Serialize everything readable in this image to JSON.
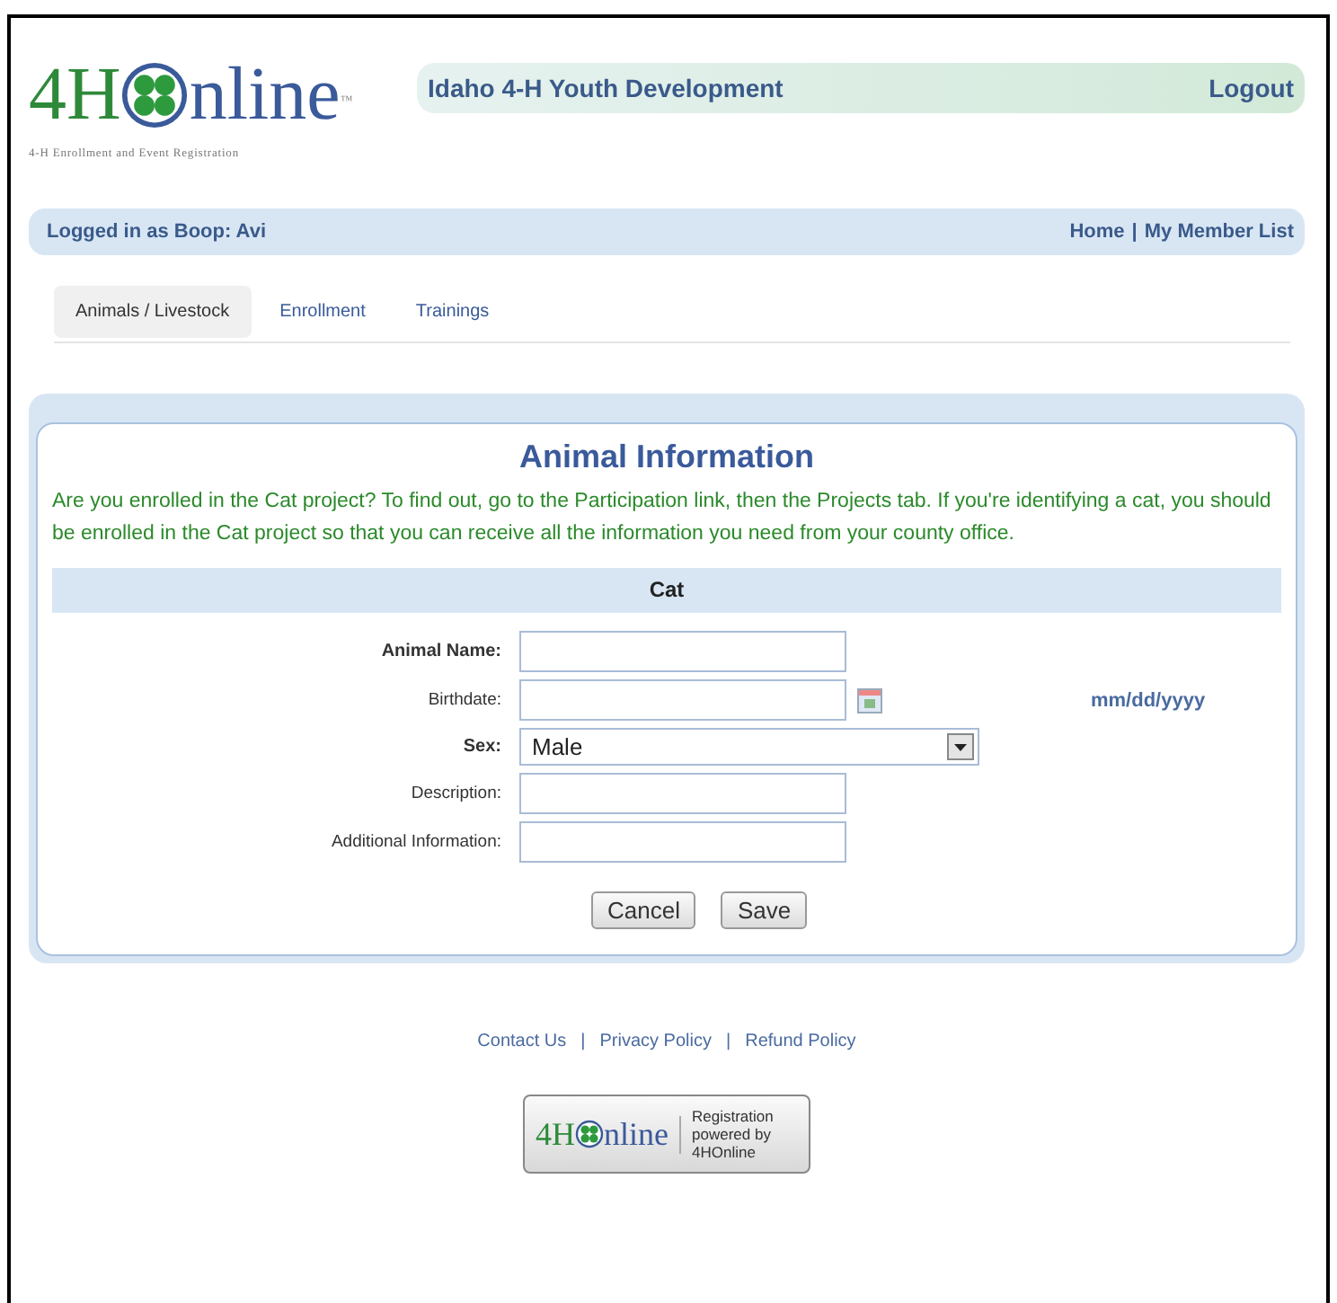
{
  "header": {
    "logo": {
      "lead": "4H",
      "tail": "nline",
      "mark": "™",
      "tagline": "4-H Enrollment and Event Registration"
    },
    "title": "Idaho 4-H Youth Development",
    "logout": "Logout"
  },
  "user_bar": {
    "status": "Logged in as Boop: Avi",
    "links": [
      "Home",
      "My Member List"
    ],
    "separator": "|"
  },
  "tabs": [
    {
      "label": "Animals / Livestock",
      "selected": true
    },
    {
      "label": "Enrollment",
      "selected": false
    },
    {
      "label": "Trainings",
      "selected": false
    }
  ],
  "card": {
    "title": "Animal Information",
    "message": "Are you enrolled in the Cat project? To find out, go to the Participation link, then the Projects tab. If you're identifying a cat, you should be enrolled in the Cat project so that you can receive all the information you need from your county office.",
    "section": "Cat",
    "fields": [
      {
        "label": "Animal Name:",
        "kind": "text",
        "required": true
      },
      {
        "label": "Birthdate:",
        "kind": "date",
        "required": false,
        "hint": "mm/dd/yyyy"
      },
      {
        "label": "Sex:",
        "kind": "select",
        "required": true,
        "value": "Male"
      },
      {
        "label": "Description:",
        "kind": "text",
        "required": false
      },
      {
        "label": "Additional Information:",
        "kind": "text",
        "required": false
      }
    ],
    "buttons": [
      "Cancel",
      "Save"
    ]
  },
  "footer": {
    "links": [
      "Contact Us",
      "Privacy Policy",
      "Refund Policy"
    ],
    "separator": "|",
    "badge": {
      "lead": "4H",
      "tail": "nline",
      "text": "Registration powered by 4HOnline"
    }
  }
}
